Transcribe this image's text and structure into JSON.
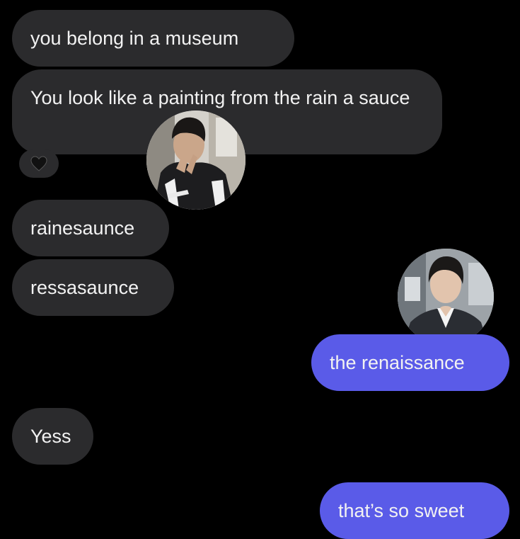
{
  "messages": [
    {
      "text": "you belong in a museum",
      "from": "them"
    },
    {
      "text": "You look like a painting from the rain a sauce",
      "from": "them"
    },
    {
      "text": "rainesaunce",
      "from": "them"
    },
    {
      "text": "ressasaunce",
      "from": "them"
    },
    {
      "text": "the renaissance",
      "from": "me"
    },
    {
      "text": "Yess",
      "from": "them"
    },
    {
      "text": "that’s so sweet",
      "from": "me"
    }
  ],
  "reaction": {
    "icon": "black-heart-icon",
    "glyph": "♥"
  },
  "colors": {
    "background": "#000000",
    "incoming_bubble": "#2b2b2d",
    "outgoing_bubble": "#5a5be8",
    "text": "#f2f2f2"
  }
}
